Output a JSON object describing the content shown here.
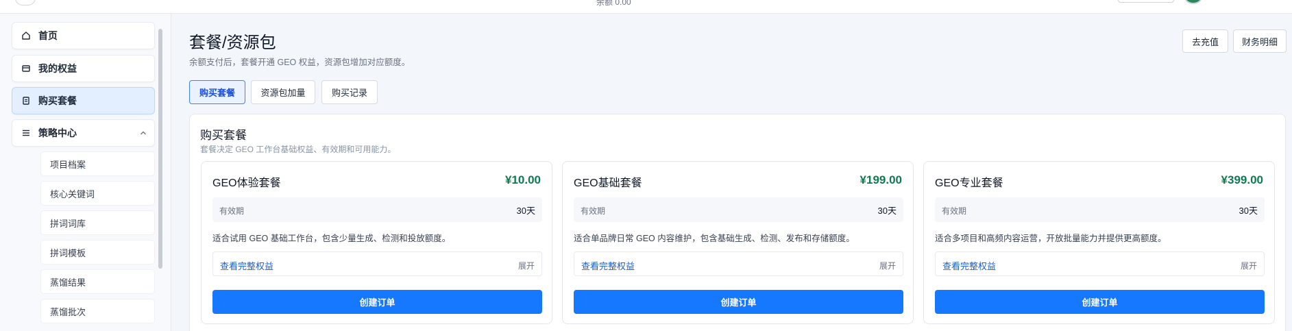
{
  "topbar": {
    "balance": "余额 0.00"
  },
  "sidebar": {
    "items": [
      {
        "label": "首页",
        "icon": "home-icon"
      },
      {
        "label": "我的权益",
        "icon": "card-icon"
      },
      {
        "label": "购买套餐",
        "icon": "receipt-icon",
        "active": true
      },
      {
        "label": "策略中心",
        "icon": "menu-icon",
        "expanded": true
      }
    ],
    "sub_items": [
      "项目档案",
      "核心关键词",
      "拼词词库",
      "拼词模板",
      "蒸馏结果",
      "蒸馏批次"
    ]
  },
  "header": {
    "title": "套餐/资源包",
    "subtitle": "余额支付后，套餐开通 GEO 权益，资源包增加对应额度。",
    "recharge_label": "去充值",
    "finance_label": "财务明细"
  },
  "tabs": [
    {
      "label": "购买套餐",
      "active": true
    },
    {
      "label": "资源包加量"
    },
    {
      "label": "购买记录"
    }
  ],
  "panel": {
    "title": "购买套餐",
    "subtitle": "套餐决定 GEO 工作台基础权益、有效期和可用能力。"
  },
  "plans": [
    {
      "name": "GEO体验套餐",
      "price": "¥10.00",
      "validity_label": "有效期",
      "validity": "30天",
      "desc": "适合试用 GEO 基础工作台，包含少量生成、检测和投放额度。",
      "rights_link": "查看完整权益",
      "expand_label": "展开",
      "order_label": "创建订单"
    },
    {
      "name": "GEO基础套餐",
      "price": "¥199.00",
      "validity_label": "有效期",
      "validity": "30天",
      "desc": "适合单品牌日常 GEO 内容维护，包含基础生成、检测、发布和存储额度。",
      "rights_link": "查看完整权益",
      "expand_label": "展开",
      "order_label": "创建订单"
    },
    {
      "name": "GEO专业套餐",
      "price": "¥399.00",
      "validity_label": "有效期",
      "validity": "30天",
      "desc": "适合多项目和高频内容运营，开放批量能力并提供更高额度。",
      "rights_link": "查看完整权益",
      "expand_label": "展开",
      "order_label": "创建订单"
    }
  ],
  "colors": {
    "primary": "#1677ff",
    "price": "#0f7a4f",
    "link": "#1d5fc9",
    "active_nav_bg": "#e3efff"
  }
}
